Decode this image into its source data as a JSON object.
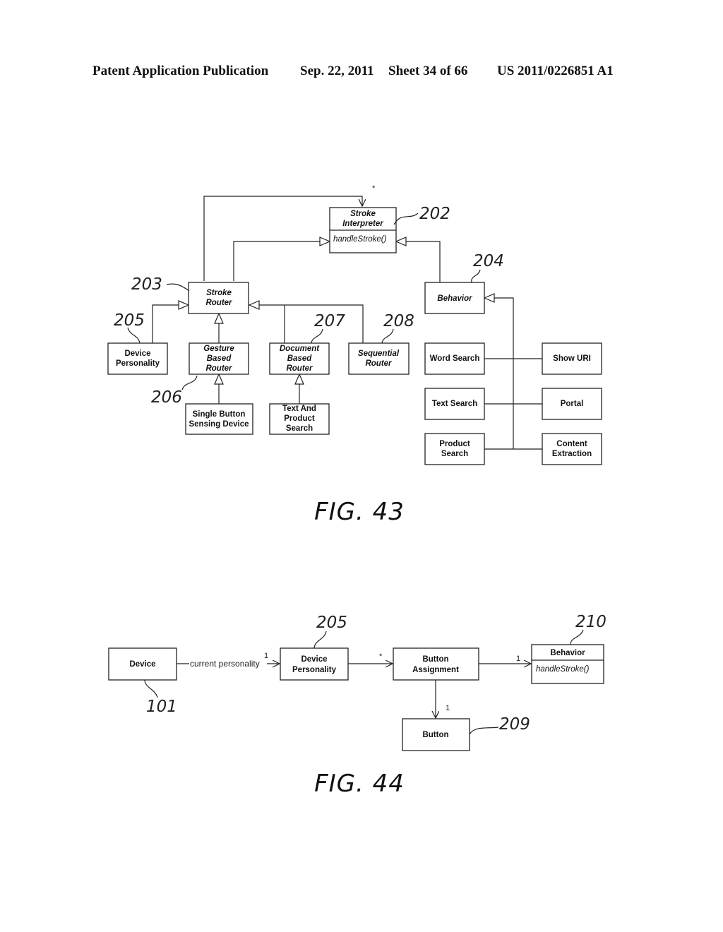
{
  "header": {
    "publication": "Patent Application Publication",
    "date": "Sep. 22, 2011",
    "sheet": "Sheet 34 of 66",
    "number": "US 2011/0226851 A1"
  },
  "fig43": {
    "caption": "FIG. 43",
    "nodes": {
      "stroke_interpreter": {
        "lines": [
          "Stroke",
          "Interpreter"
        ],
        "method": "handleStroke()",
        "ref": "202"
      },
      "stroke_router": {
        "lines": [
          "Stroke",
          "Router"
        ],
        "ref": "203"
      },
      "behavior": {
        "lines": [
          "Behavior"
        ],
        "ref": "204"
      },
      "device_personality": {
        "lines": [
          "Device",
          "Personality"
        ],
        "ref": "205"
      },
      "gesture_based_router": {
        "lines": [
          "Gesture",
          "Based",
          "Router"
        ],
        "ref": "206"
      },
      "document_based_router": {
        "lines": [
          "Document",
          "Based",
          "Router"
        ],
        "ref": "207"
      },
      "sequential_router": {
        "lines": [
          "Sequential",
          "Router"
        ],
        "ref": "208"
      },
      "single_button_sensing_device": {
        "lines": [
          "Single Button",
          "Sensing Device"
        ]
      },
      "text_and_product_search": {
        "lines": [
          "Text And",
          "Product",
          "Search"
        ]
      },
      "word_search": {
        "lines": [
          "Word Search"
        ]
      },
      "text_search": {
        "lines": [
          "Text Search"
        ]
      },
      "product_search": {
        "lines": [
          "Product",
          "Search"
        ]
      },
      "show_uri": {
        "lines": [
          "Show URI"
        ]
      },
      "portal": {
        "lines": [
          "Portal"
        ]
      },
      "content_extraction": {
        "lines": [
          "Content",
          "Extraction"
        ]
      }
    },
    "star_mark": "*"
  },
  "fig44": {
    "caption": "FIG. 44",
    "nodes": {
      "device": {
        "lines": [
          "Device"
        ],
        "ref": "101"
      },
      "device_personality": {
        "lines": [
          "Device",
          "Personality"
        ],
        "ref": "205"
      },
      "button_assignment": {
        "lines": [
          "Button",
          "Assignment"
        ]
      },
      "behavior": {
        "title": "Behavior",
        "method": "handleStroke()",
        "ref": "210"
      },
      "button": {
        "lines": [
          "Button"
        ],
        "ref": "209"
      }
    },
    "edges": {
      "device_to_personality": {
        "label": "current personality",
        "multiplicity": "1"
      },
      "personality_to_assignment": {
        "multiplicity": "*"
      },
      "assignment_to_behavior": {
        "multiplicity": "1"
      },
      "assignment_to_button": {
        "multiplicity": "1"
      }
    }
  }
}
